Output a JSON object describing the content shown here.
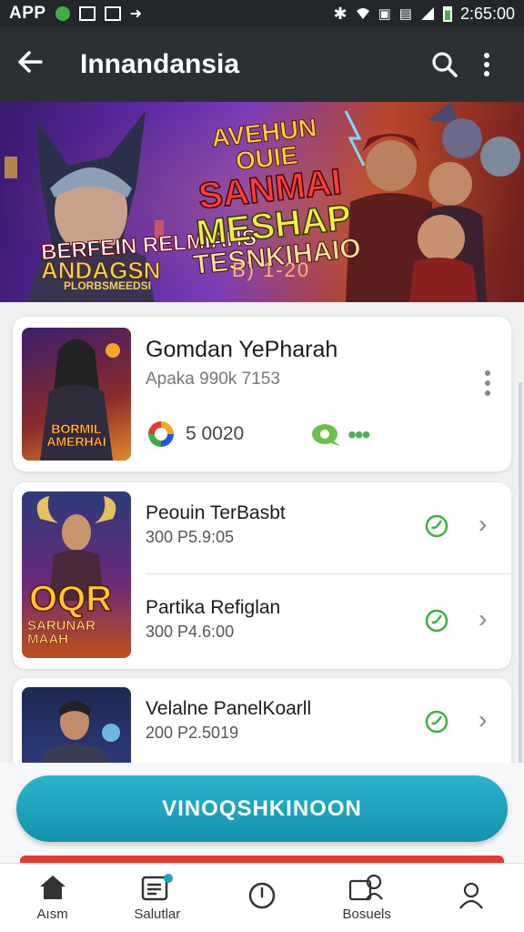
{
  "status_bar": {
    "app_label": "APP",
    "time": "2:65:00"
  },
  "app_bar": {
    "title": "Innandansia",
    "back_icon": "arrow-left-icon",
    "search_icon": "search-icon",
    "more_icon": "more-vert-icon"
  },
  "banner": {
    "line1": "AVEHUN OUIE",
    "line2": "SANMAI",
    "line3": "MESHAP",
    "line4": "TESNKIHAIO",
    "date": "B) 1-20",
    "hood_text": "BERFEIN RELMIAHS",
    "logo": "ANDAGSN",
    "logo_sub": "PLORBSMEEDSI"
  },
  "featured_card": {
    "title": "Gomdan YePharah",
    "subtitle": "Apaka 990k 7153",
    "stat": "5 0020",
    "thumb_text": "BORMIL AMERHAI"
  },
  "list_items": [
    {
      "title": "Peouin TerBasbt",
      "subtitle": "300 P5.9:05"
    },
    {
      "title": "Partika Refiglan",
      "subtitle": "300 P4.6:00"
    },
    {
      "title": "Velalne PanelKoarll",
      "subtitle": "200 P2.5019"
    }
  ],
  "thumb2_text": {
    "big": "OQR",
    "sub": "SARUNAR MAAH"
  },
  "cta": {
    "label": "VINOQSHKINOON"
  },
  "bottom_nav": [
    {
      "label": "Aısm",
      "icon": "home-icon"
    },
    {
      "label": "Salutlar",
      "icon": "calendar-list-icon"
    },
    {
      "label": "",
      "icon": "clock-icon"
    },
    {
      "label": "Bosuels",
      "icon": "people-icon"
    },
    {
      "label": "",
      "icon": "profile-icon"
    }
  ],
  "colors": {
    "app_bar": "#2b3033",
    "cta": "#1ea6c0",
    "accent_green": "#4caf50",
    "danger": "#e23a2e"
  }
}
